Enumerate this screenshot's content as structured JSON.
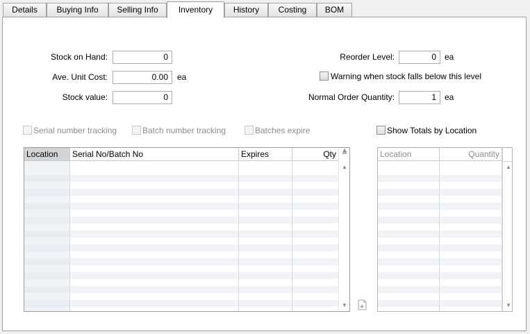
{
  "tabs": [
    {
      "label": "Details"
    },
    {
      "label": "Buying Info"
    },
    {
      "label": "Selling Info"
    },
    {
      "label": "Inventory"
    },
    {
      "label": "History"
    },
    {
      "label": "Costing"
    },
    {
      "label": "BOM"
    }
  ],
  "stock": {
    "stock_on_hand_label": "Stock on Hand:",
    "stock_on_hand_value": "0",
    "ave_unit_cost_label": "Ave. Unit Cost:",
    "ave_unit_cost_value": "0.00",
    "ave_unit_cost_unit": "ea",
    "stock_value_label": "Stock value:",
    "stock_value_value": "0"
  },
  "reorder": {
    "reorder_level_label": "Reorder Level:",
    "reorder_level_value": "0",
    "reorder_level_unit": "ea",
    "warning_label": "Warning when stock falls below this level",
    "normal_order_qty_label": "Normal Order Quantity:",
    "normal_order_qty_value": "1",
    "normal_order_qty_unit": "ea"
  },
  "options": {
    "serial_tracking": "Serial number tracking",
    "batch_tracking": "Batch number tracking",
    "batches_expire": "Batches expire",
    "show_totals": "Show Totals by Location"
  },
  "serial_grid": {
    "columns": [
      "Location",
      "Serial No/Batch No",
      "Expires",
      "Qty"
    ]
  },
  "totals_grid": {
    "columns": [
      "Location",
      "Quantity"
    ]
  }
}
